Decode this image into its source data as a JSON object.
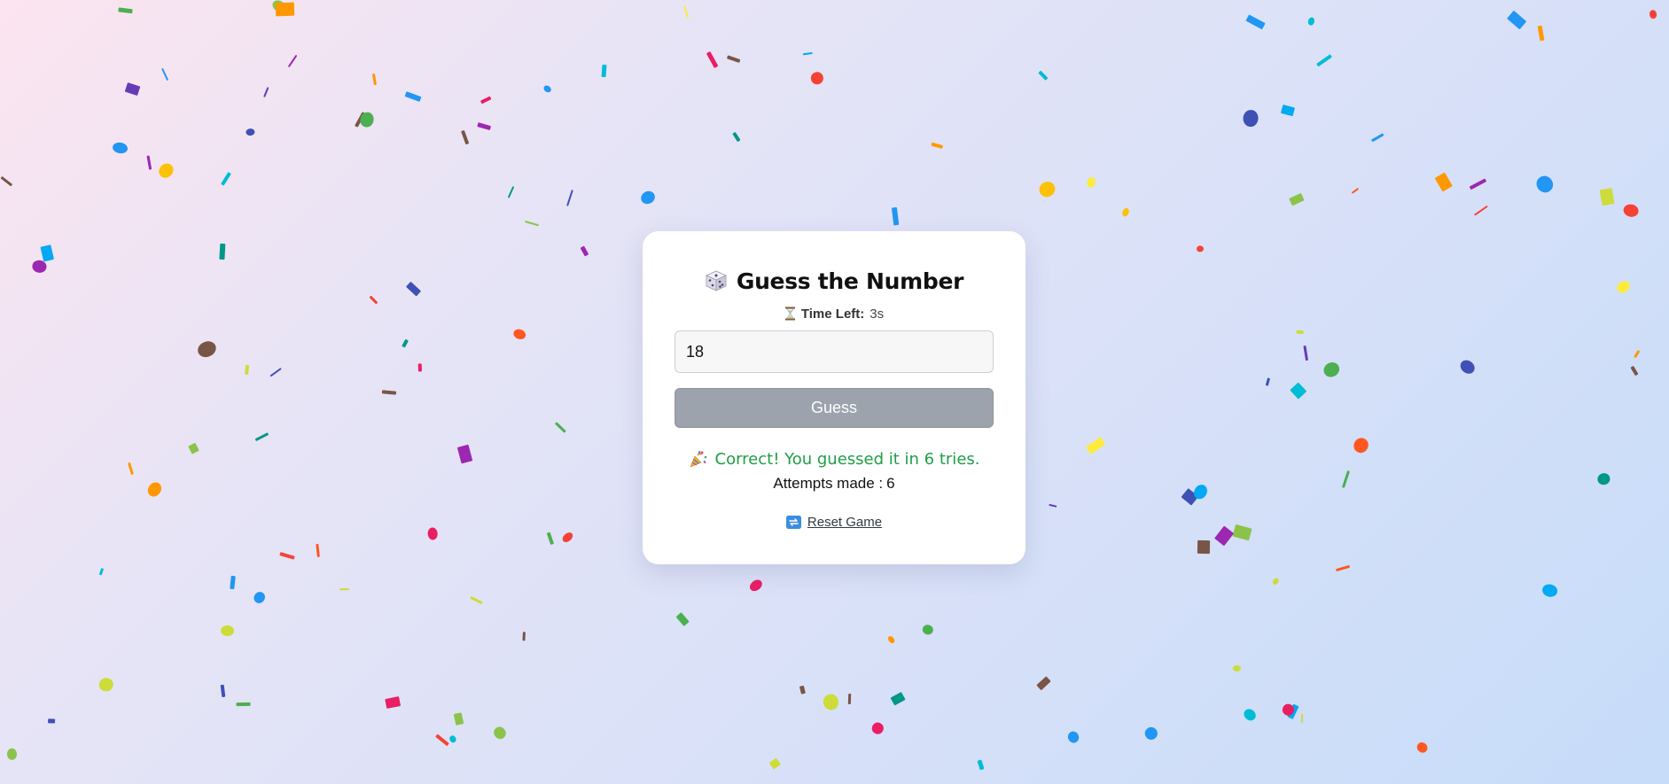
{
  "app": {
    "title": "Guess the Number",
    "title_icon": "die-icon"
  },
  "timer": {
    "icon": "hourglass-icon",
    "label": "Time Left:",
    "value": "3s"
  },
  "guess_input": {
    "value": "18",
    "placeholder": ""
  },
  "guess_button": {
    "label": "Guess",
    "disabled": true
  },
  "result": {
    "icon": "party-popper-icon",
    "message": "Correct! You guessed it in 6 tries.",
    "color": "#1e9e45"
  },
  "attempts": {
    "label": "Attempts made :",
    "count": "6"
  },
  "reset": {
    "icon": "reset-icon",
    "label": "Reset Game"
  },
  "colors": {
    "card_background": "#ffffff",
    "button_disabled": "#9ca3ad",
    "success_text": "#1e9e45",
    "confetti_palette": [
      "#f44336",
      "#e91e63",
      "#9c27b0",
      "#673ab7",
      "#3f51b5",
      "#2196f3",
      "#03a9f4",
      "#00bcd4",
      "#009688",
      "#4caf50",
      "#8bc34a",
      "#cddc39",
      "#ffeb3b",
      "#ffc107",
      "#ff9800",
      "#ff5722",
      "#795548"
    ]
  }
}
